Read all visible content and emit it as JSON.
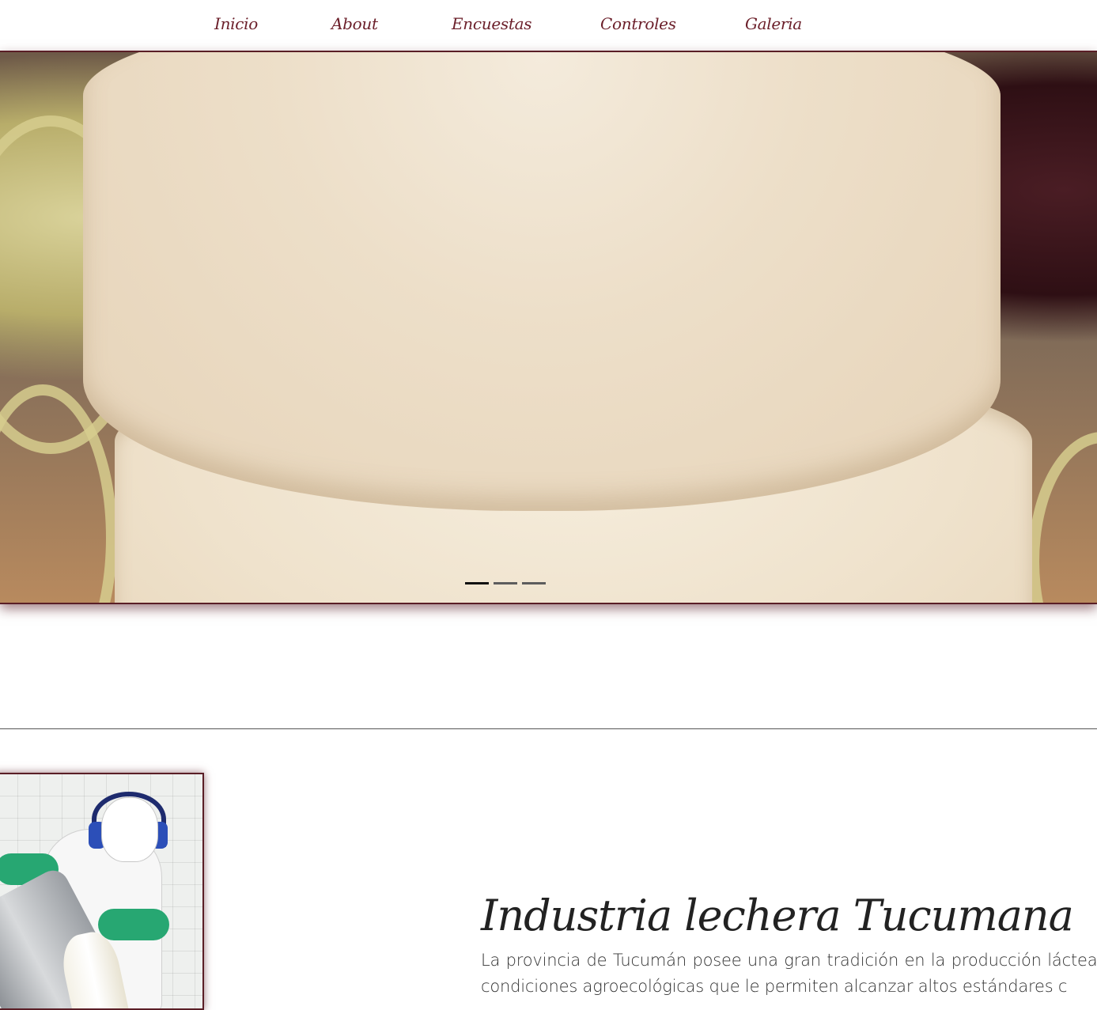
{
  "nav": {
    "items": [
      {
        "label": "Inicio"
      },
      {
        "label": "About"
      },
      {
        "label": "Encuestas"
      },
      {
        "label": "Controles"
      },
      {
        "label": "Galeria"
      }
    ]
  },
  "carousel": {
    "image_alt": "Queso fresco",
    "slide_count": 3,
    "active_index": 0
  },
  "section": {
    "title": "Industria lechera Tucumana",
    "body": "La provincia de Tucumán posee una gran tradición en la producción láctea d condiciones agroecológicas que le permiten alcanzar altos estándares c"
  },
  "colors": {
    "accent": "#6b1f2a",
    "border": "#5a1e26",
    "text": "#333333"
  }
}
